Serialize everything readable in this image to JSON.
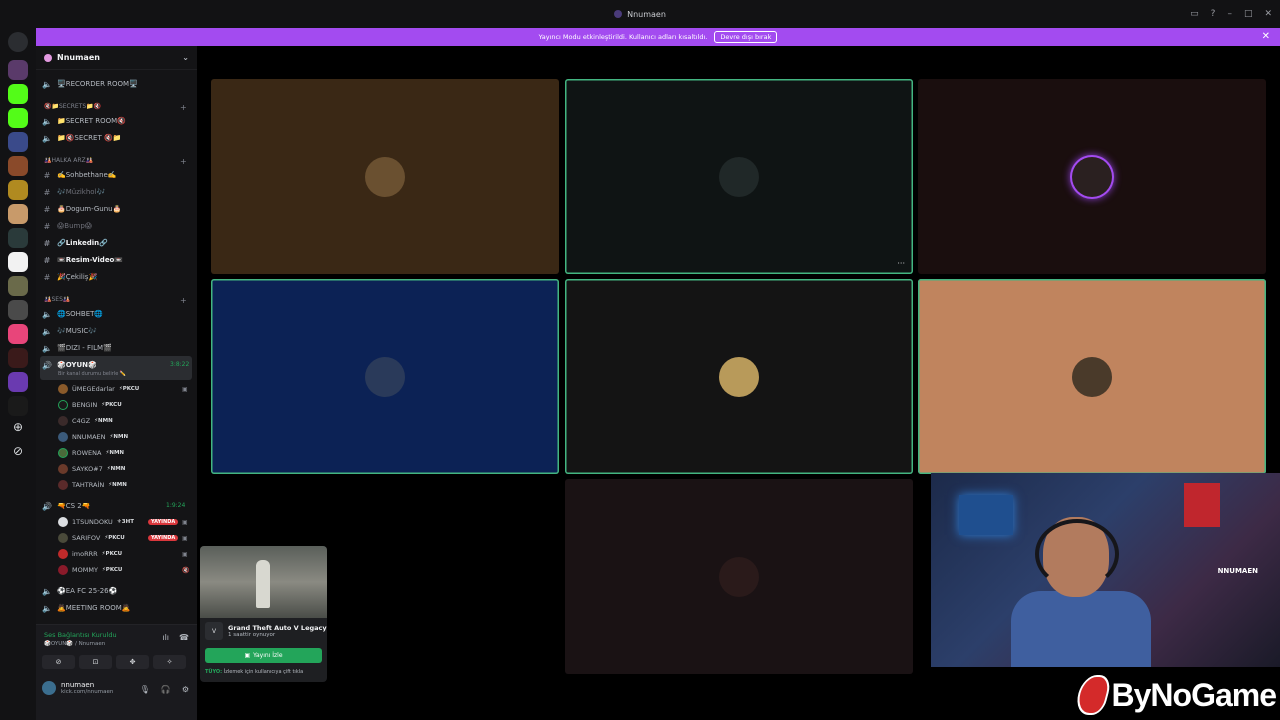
{
  "window": {
    "title": "Nnumaen"
  },
  "banner": {
    "text": "Yayıncı Modu etkinleştirildi. Kullanıcı adları kısaltıldı.",
    "button": "Devre dışı bırak"
  },
  "server": {
    "name": "Nnumaen"
  },
  "channels": {
    "recorder": "🖥️RECORDER ROOM🖥️",
    "cat_secrets": "🔇📁SECRETS📁🔇",
    "secret_room": "📁SECRET ROOM🔇",
    "secret": "📁🔇SECRET 🔇📁",
    "cat_halka": "🎎HALKA ARZ🎎",
    "sohbethane": "✍️Sohbethane✍️",
    "muzikhol": "🎶Müzikhol🎶",
    "dogum": "🎂Dogum-Gunu🎂",
    "bump": "😱Bump😱",
    "linkedin": "🔗Linkedin🔗",
    "resim": "📼Resim-Video📼",
    "cekilis": "🎉Çekiliş🎉",
    "cat_ses": "🎎SES🎎",
    "sohbet": "🌐SOHBET🌐",
    "music": "🎶MUSIC🎶",
    "dizi": "🎬DIZI - FILM🎬",
    "oyun": "🎲OYUN🎲",
    "oyun_timer": "3:8:22",
    "oyun_status": "Bir kanal durumu belirle ✏️",
    "cs2": "🔫CS 2🔫",
    "cs2_timer": "1:9:24",
    "eafc": "⚽EA FC 25-26⚽",
    "meeting": "🙇MEETING ROOM🙇"
  },
  "oyun_users": [
    {
      "name": "ÜMEGEdarlar",
      "tag": "⚡PKCU"
    },
    {
      "name": "BENGIN",
      "tag": "⚡PKCU"
    },
    {
      "name": "C4GZ",
      "tag": "⚡NMN"
    },
    {
      "name": "NNUMAEN",
      "tag": "⚡NMN"
    },
    {
      "name": "ROWENA",
      "tag": "⚡NMN"
    },
    {
      "name": "SAYKO#7",
      "tag": "⚡NMN"
    },
    {
      "name": "TAHTRAİN",
      "tag": "⚡NMN"
    }
  ],
  "cs2_users": [
    {
      "name": "1TSUNDOKU",
      "tag": "⚜3HT",
      "live": "YAYINDA"
    },
    {
      "name": "SARIFOV",
      "tag": "⚡PKCU",
      "live": "YAYINDA"
    },
    {
      "name": "imoRRR",
      "tag": "⚡PKCU",
      "live": ""
    },
    {
      "name": "MOMMY",
      "tag": "⚡PKCU",
      "live": ""
    }
  ],
  "voice_panel": {
    "status": "Ses Bağlantısı Kuruldu",
    "sub": "🎲OYUN🎲 / Nnumaen",
    "username": "nnumaen",
    "user_status": "kick.com/nnumaen"
  },
  "popup": {
    "game": "Grand Theft Auto V Legacy",
    "played": "1 saattir oynuyor",
    "watch": "Yayını İzle",
    "tip_label": "TÜYO:",
    "tip_text": "İzlemek için kullanıcıya çift tıkla"
  },
  "webcam": {
    "name": "NNUMAEN"
  },
  "watermark": {
    "text": "ByNoGame"
  },
  "colors": {
    "accent": "#a34bf0",
    "speaking": "#43b581",
    "live": "#da373c",
    "connected": "#23a55a"
  }
}
